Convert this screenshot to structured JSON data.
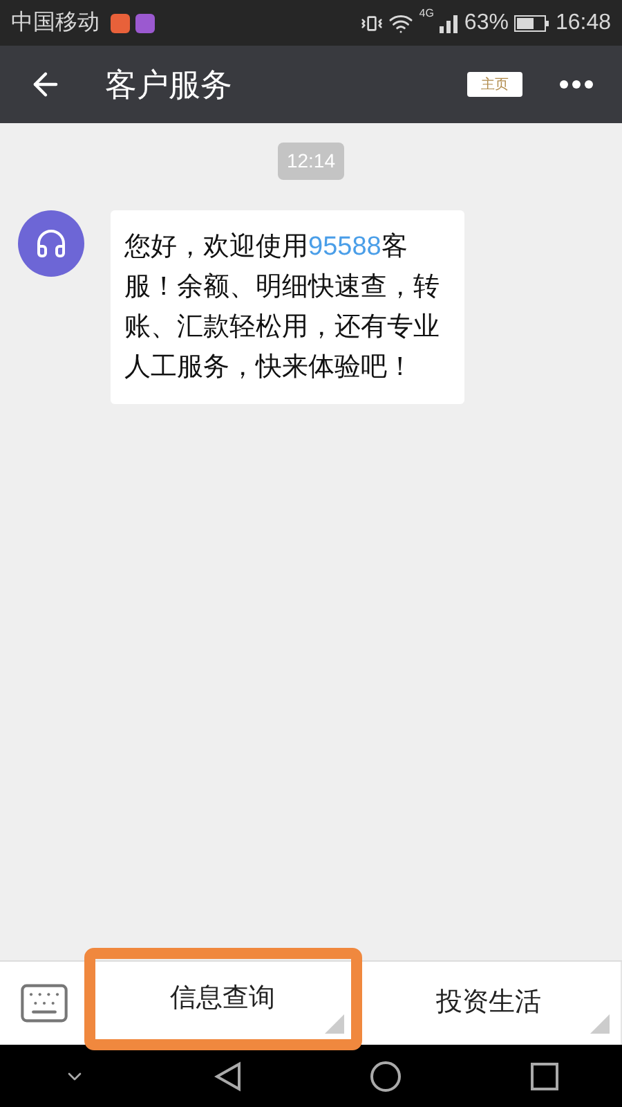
{
  "status_bar": {
    "carrier": "中国移动",
    "network": "4G",
    "battery": "63%",
    "time": "16:48"
  },
  "header": {
    "title": "客户服务",
    "home_badge": "主页"
  },
  "chat": {
    "timestamp": "12:14",
    "messages": [
      {
        "kind": "incoming",
        "parts": [
          {
            "kind": "plain",
            "text": "您好，欢迎使用"
          },
          {
            "kind": "link",
            "text": "95588"
          },
          {
            "kind": "plain",
            "text": "客服！余额、明细快速查，转账、汇款轻松用，还有专业人工服务，快来体验吧！"
          }
        ]
      }
    ]
  },
  "menu": [
    {
      "label": "信息查询",
      "highlighted": true
    },
    {
      "label": "投资生活",
      "highlighted": false
    }
  ]
}
